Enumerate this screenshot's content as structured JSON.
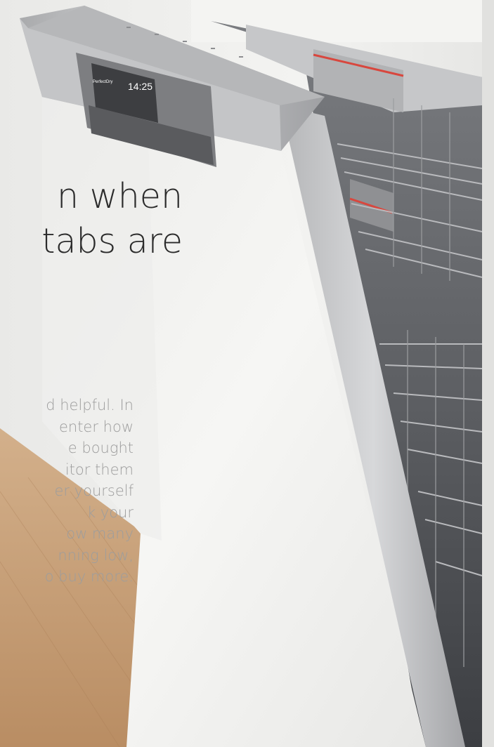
{
  "headline": {
    "lines": [
      "n when",
      "tabs are"
    ]
  },
  "body_copy": {
    "lines": [
      "d helpful. In",
      "enter how",
      "e bought",
      "itor them",
      "er yourself",
      "k your",
      "ow many",
      "nning low,",
      "o buy more."
    ]
  },
  "control_panel": {
    "brand": "PerfectDry",
    "time": "14:25"
  },
  "colors": {
    "wall": "#eeeeec",
    "floor": "#c9a27c",
    "door": "#f2f2f0",
    "steel": "#bfc0c2",
    "accent_red": "#d8473e",
    "headline_text": "#2b2b2b",
    "body_text": "#9d9d9d"
  }
}
